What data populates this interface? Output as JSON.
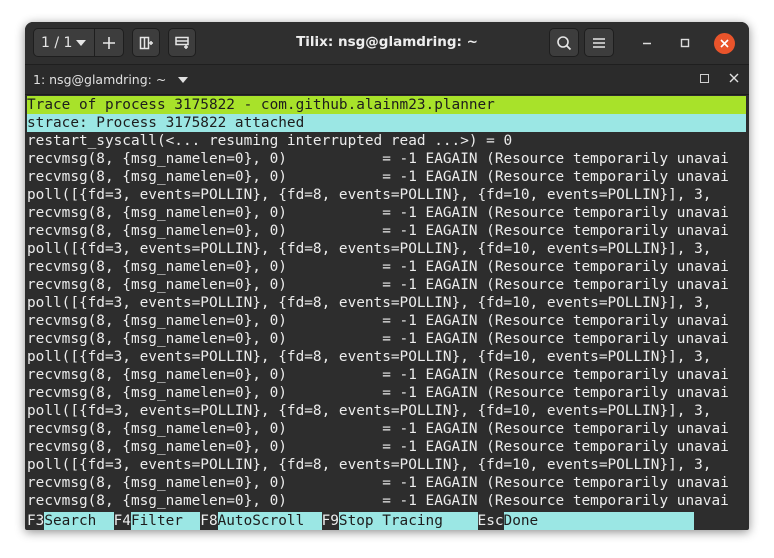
{
  "titlebar": {
    "session_label": "1 / 1",
    "title": "Tilix: nsg@glamdring: ~"
  },
  "tab": {
    "title": "1: nsg@glamdring: ~"
  },
  "terminal": {
    "header_line": "Trace of process 3175822 - com.github.alainm23.planner",
    "attach_line": "strace: Process 3175822 attached",
    "lines": [
      "restart_syscall(<... resuming interrupted read ...>) = 0",
      "recvmsg(8, {msg_namelen=0}, 0)           = -1 EAGAIN (Resource temporarily unavai",
      "recvmsg(8, {msg_namelen=0}, 0)           = -1 EAGAIN (Resource temporarily unavai",
      "poll([{fd=3, events=POLLIN}, {fd=8, events=POLLIN}, {fd=10, events=POLLIN}], 3,",
      "recvmsg(8, {msg_namelen=0}, 0)           = -1 EAGAIN (Resource temporarily unavai",
      "recvmsg(8, {msg_namelen=0}, 0)           = -1 EAGAIN (Resource temporarily unavai",
      "poll([{fd=3, events=POLLIN}, {fd=8, events=POLLIN}, {fd=10, events=POLLIN}], 3,",
      "recvmsg(8, {msg_namelen=0}, 0)           = -1 EAGAIN (Resource temporarily unavai",
      "recvmsg(8, {msg_namelen=0}, 0)           = -1 EAGAIN (Resource temporarily unavai",
      "poll([{fd=3, events=POLLIN}, {fd=8, events=POLLIN}, {fd=10, events=POLLIN}], 3,",
      "recvmsg(8, {msg_namelen=0}, 0)           = -1 EAGAIN (Resource temporarily unavai",
      "recvmsg(8, {msg_namelen=0}, 0)           = -1 EAGAIN (Resource temporarily unavai",
      "poll([{fd=3, events=POLLIN}, {fd=8, events=POLLIN}, {fd=10, events=POLLIN}], 3,",
      "recvmsg(8, {msg_namelen=0}, 0)           = -1 EAGAIN (Resource temporarily unavai",
      "recvmsg(8, {msg_namelen=0}, 0)           = -1 EAGAIN (Resource temporarily unavai",
      "poll([{fd=3, events=POLLIN}, {fd=8, events=POLLIN}, {fd=10, events=POLLIN}], 3,",
      "recvmsg(8, {msg_namelen=0}, 0)           = -1 EAGAIN (Resource temporarily unavai",
      "recvmsg(8, {msg_namelen=0}, 0)           = -1 EAGAIN (Resource temporarily unavai",
      "poll([{fd=3, events=POLLIN}, {fd=8, events=POLLIN}, {fd=10, events=POLLIN}], 3,",
      "recvmsg(8, {msg_namelen=0}, 0)           = -1 EAGAIN (Resource temporarily unavai",
      "recvmsg(8, {msg_namelen=0}, 0)           = -1 EAGAIN (Resource temporarily unavai"
    ]
  },
  "fkeys": [
    {
      "key": "F3",
      "label": "Search  "
    },
    {
      "key": "F4",
      "label": "Filter  "
    },
    {
      "key": "F8",
      "label": "AutoScroll  "
    },
    {
      "key": "F9",
      "label": "Stop Tracing    "
    },
    {
      "key": "Esc",
      "label": "Done                  "
    }
  ],
  "icons": {
    "add": "plus-icon",
    "split_right": "split-right-icon",
    "split_down": "split-down-icon",
    "search": "search-icon",
    "menu": "hamburger-menu-icon",
    "minimize": "minimize-icon",
    "maximize": "maximize-icon",
    "close": "close-icon"
  },
  "colors": {
    "header_highlight": "#a8e22a",
    "attach_highlight": "#9be7e4",
    "fkey_label_bg": "#9be7e4",
    "close_button": "#e9542b",
    "terminal_bg": "#2d2d2d"
  }
}
